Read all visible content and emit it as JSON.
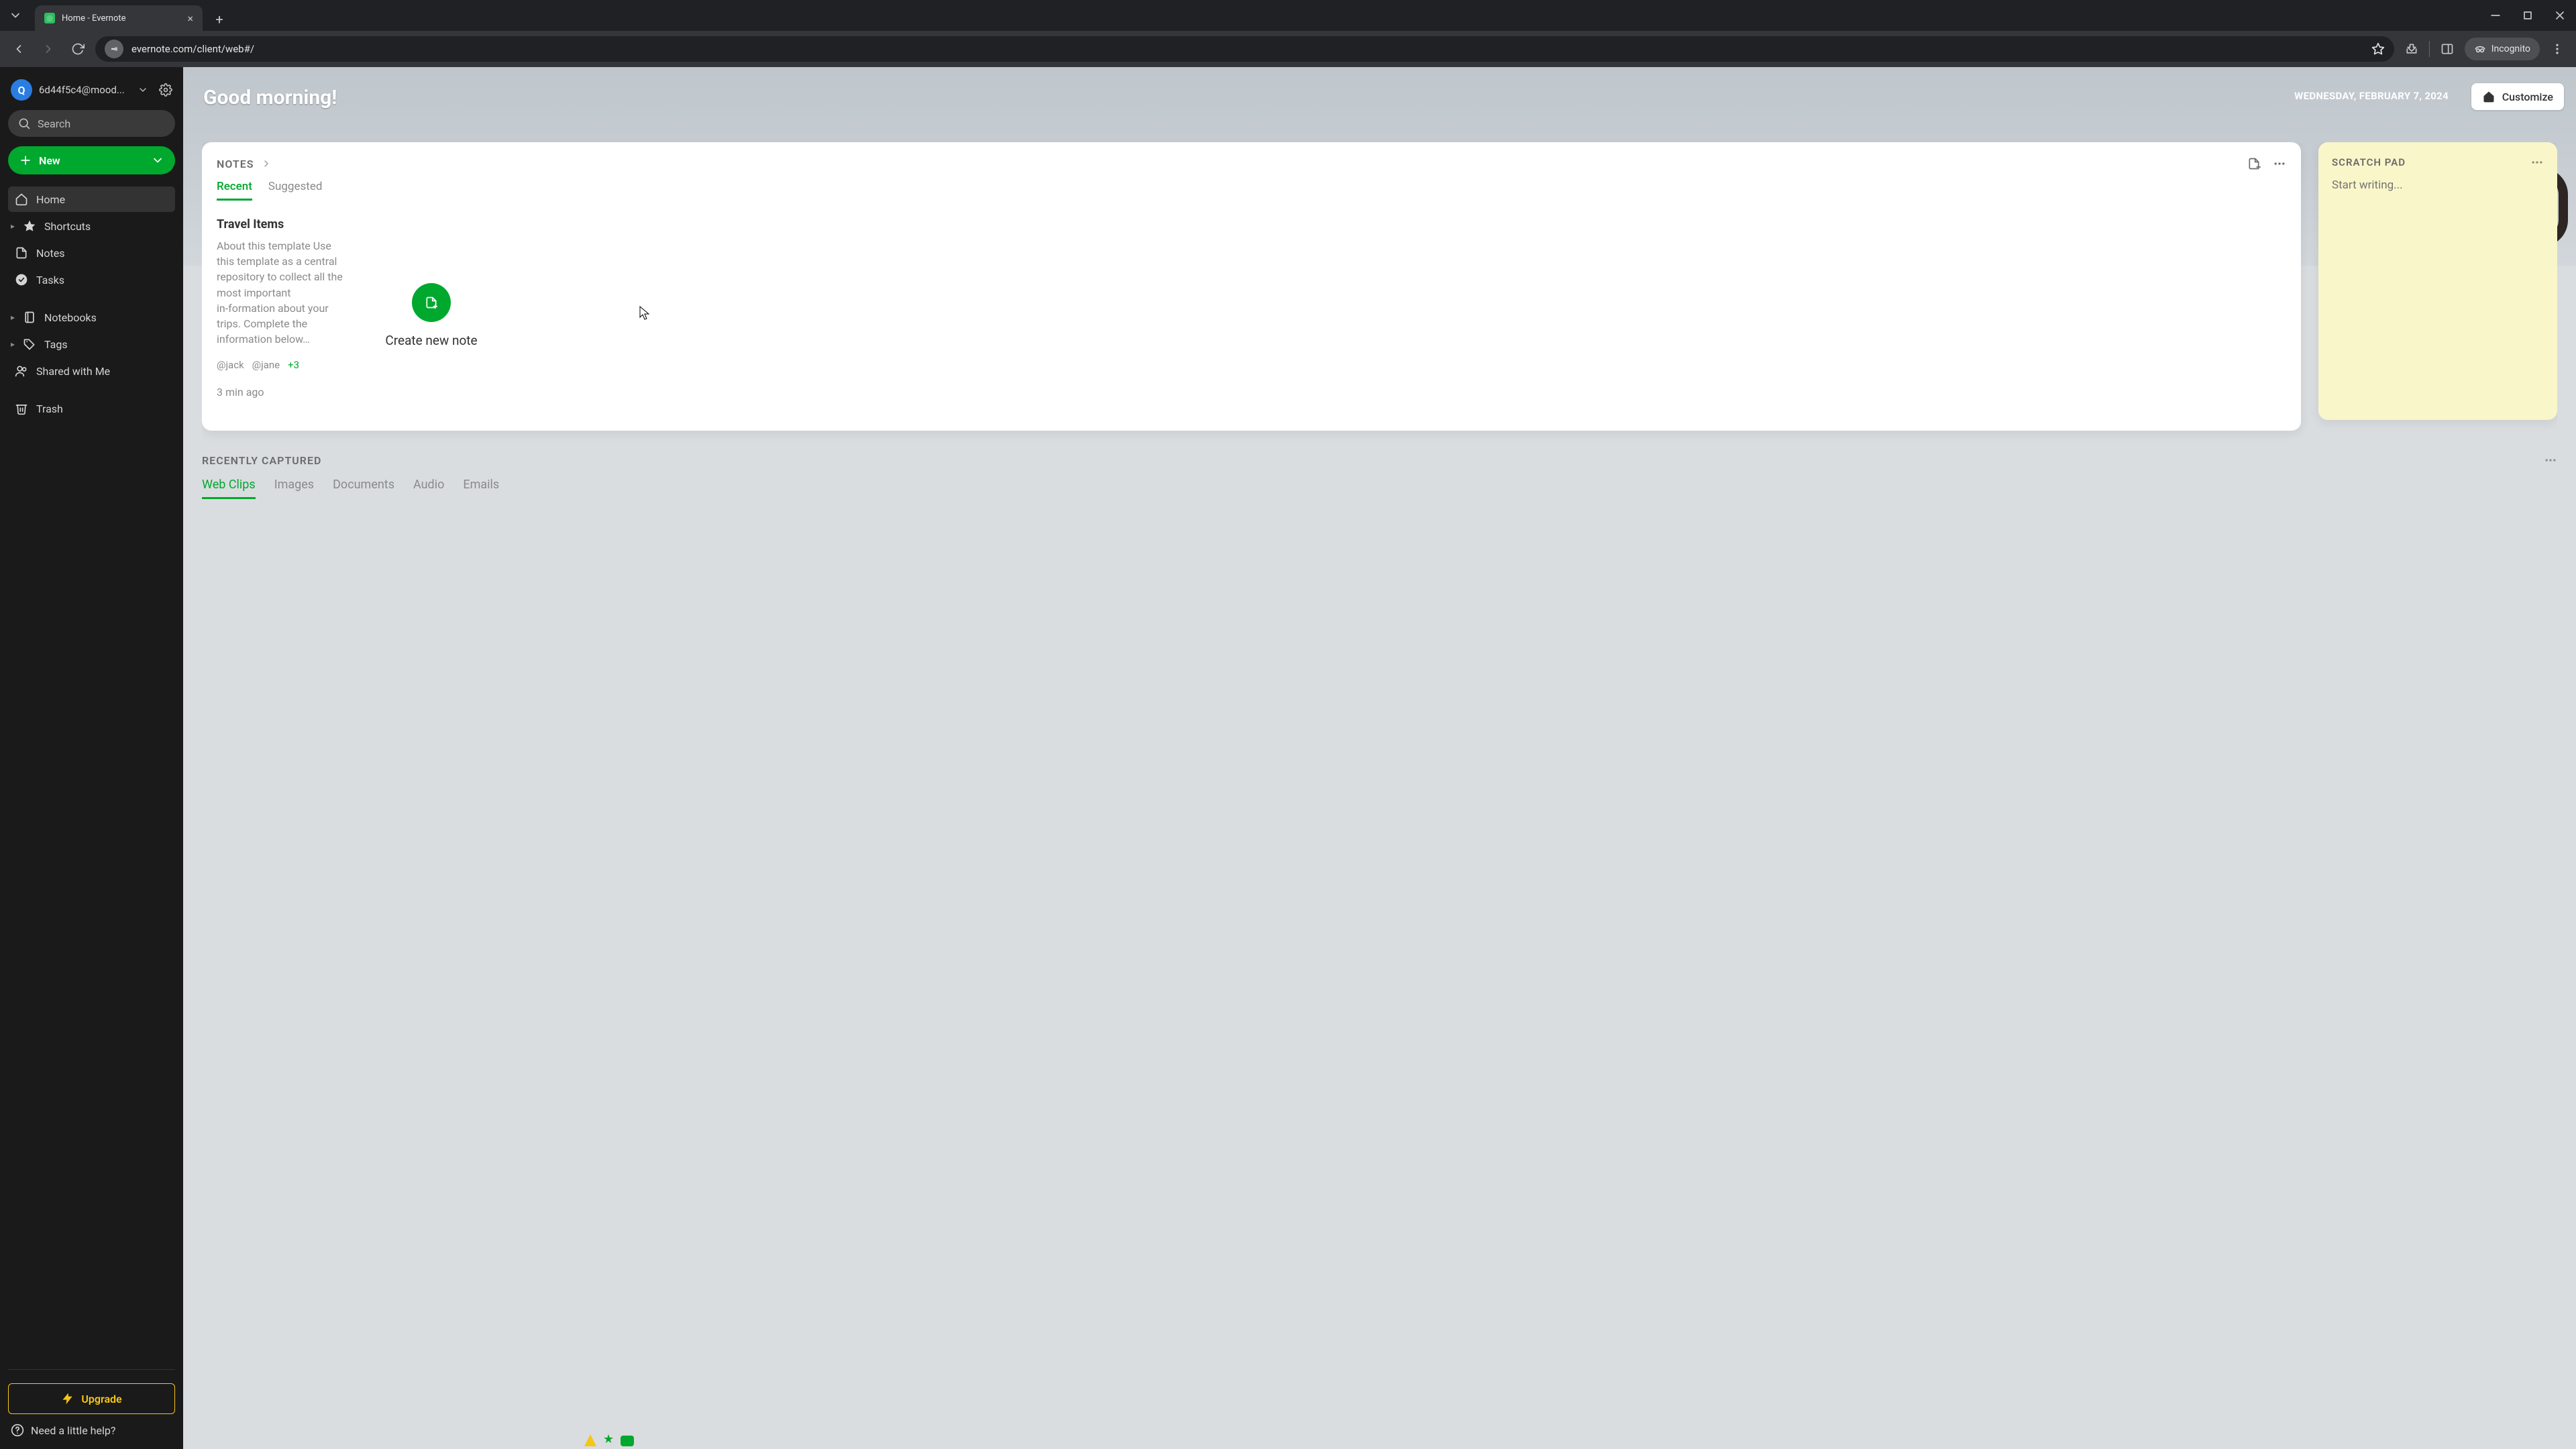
{
  "browser": {
    "tab_title": "Home - Evernote",
    "url": "evernote.com/client/web#/",
    "incognito_label": "Incognito"
  },
  "sidebar": {
    "avatar_initial": "Q",
    "account_name": "6d44f5c4@mood...",
    "search_placeholder": "Search",
    "new_label": "New",
    "nav": {
      "home": "Home",
      "shortcuts": "Shortcuts",
      "notes": "Notes",
      "tasks": "Tasks",
      "notebooks": "Notebooks",
      "tags": "Tags",
      "shared": "Shared with Me",
      "trash": "Trash"
    },
    "upgrade_label": "Upgrade",
    "help_label": "Need a little help?"
  },
  "header": {
    "greeting": "Good morning!",
    "date": "WEDNESDAY, FEBRUARY 7, 2024",
    "customize_label": "Customize"
  },
  "notes": {
    "title": "NOTES",
    "tabs": {
      "recent": "Recent",
      "suggested": "Suggested"
    },
    "tile": {
      "title": "Travel Items",
      "snippet": "About this template Use this template as a central repository to collect all the most important in‑formation about your trips. Complete the information below…",
      "tags": [
        "@jack",
        "@jane"
      ],
      "tags_more": "+3",
      "time": "3 min ago"
    },
    "create_label": "Create new note"
  },
  "scratch": {
    "title": "SCRATCH PAD",
    "placeholder": "Start writing..."
  },
  "recent": {
    "title": "RECENTLY CAPTURED",
    "tabs": [
      "Web Clips",
      "Images",
      "Documents",
      "Audio",
      "Emails"
    ]
  }
}
